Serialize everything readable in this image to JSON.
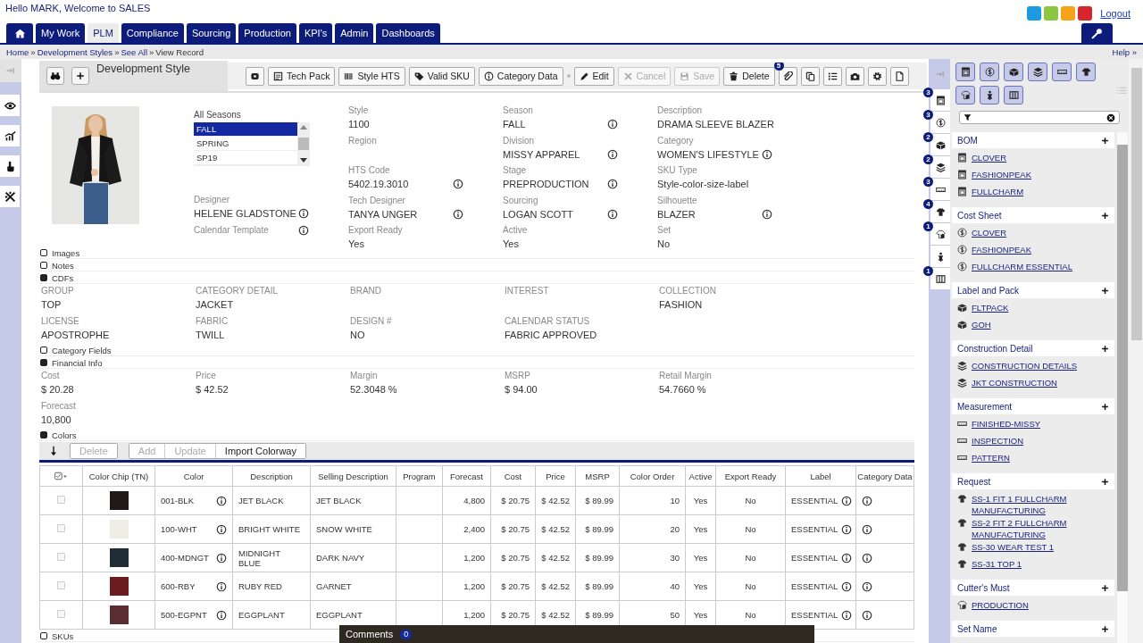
{
  "header": {
    "greeting": "Hello MARK, Welcome to SALES",
    "swatches": [
      {
        "color": "#1e9be0"
      },
      {
        "color": "#8dc63f"
      },
      {
        "color": "#f7a21b"
      },
      {
        "color": "#d7262b"
      }
    ],
    "logout": "Logout"
  },
  "nav": {
    "tabs": [
      {
        "kind": "home",
        "selected": false
      },
      {
        "label": "My Work",
        "selected": false
      },
      {
        "label": "PLM",
        "selected": true
      },
      {
        "label": "Compliance",
        "selected": false
      },
      {
        "label": "Sourcing",
        "selected": false
      },
      {
        "label": "Production",
        "selected": false
      },
      {
        "label": "KPI's",
        "selected": false
      },
      {
        "label": "Admin",
        "selected": false
      },
      {
        "label": "Dashboards",
        "selected": false
      }
    ]
  },
  "breadcrumb": {
    "separator": "»",
    "items": [
      "Home",
      "Development Styles",
      "See All",
      "View Record"
    ],
    "help": "Help »"
  },
  "toolbar": {
    "title": "Development Style",
    "buttons": [
      {
        "kind": "stop",
        "disabled": false
      },
      {
        "kind": "pdf",
        "label": "Tech Pack",
        "disabled": false
      },
      {
        "kind": "barcode",
        "label": "Style HTS",
        "disabled": false
      },
      {
        "kind": "tag",
        "label": "Valid SKU",
        "disabled": false
      },
      {
        "kind": "info",
        "label": "Category Data",
        "disabled": false
      },
      {
        "kind": "separator"
      },
      {
        "kind": "pencil",
        "label": "Edit",
        "disabled": false
      },
      {
        "kind": "cancel",
        "label": "Cancel",
        "disabled": true
      },
      {
        "kind": "save",
        "label": "Save",
        "disabled": true
      },
      {
        "kind": "trash",
        "label": "Delete",
        "disabled": false
      },
      {
        "kind": "paperclip",
        "badge": "5",
        "disabled": false
      },
      {
        "kind": "copy",
        "disabled": false
      },
      {
        "kind": "list",
        "disabled": false
      },
      {
        "kind": "camera",
        "disabled": false
      },
      {
        "kind": "gear",
        "disabled": false
      },
      {
        "kind": "document",
        "disabled": false
      }
    ]
  },
  "record": {
    "seasons": {
      "label": "All Seasons",
      "items": [
        {
          "label": "FALL",
          "selected": true
        },
        {
          "label": "SPRING",
          "selected": false
        },
        {
          "label": "SP19",
          "selected": false
        }
      ]
    },
    "seasons_column": [
      {
        "label": "Designer",
        "value": "HELENE GLADSTONE",
        "info": true
      },
      {
        "label": "Calendar Template",
        "info": true
      }
    ],
    "columns": [
      [
        {
          "label": "Style",
          "value": "1100",
          "info": false
        },
        {
          "label": "Region",
          "info": false
        },
        {
          "label": "HTS Code",
          "value": "5402.19.3010",
          "info": true
        },
        {
          "label": "Tech Designer",
          "value": "TANYA UNGER",
          "info": true
        },
        {
          "label": "Export Ready",
          "value": "Yes",
          "info": false
        }
      ],
      [
        {
          "label": "Season",
          "value": "FALL",
          "info": true
        },
        {
          "label": "Division",
          "value": "MISSY APPAREL",
          "info": true
        },
        {
          "label": "Stage",
          "value": "PREPRODUCTION",
          "info": true
        },
        {
          "label": "Sourcing",
          "value": "LOGAN SCOTT",
          "info": true
        },
        {
          "label": "Active",
          "value": "Yes",
          "info": false
        }
      ],
      [
        {
          "label": "Description",
          "value": "DRAMA SLEEVE BLAZER",
          "info": false
        },
        {
          "label": "Category",
          "value": "WOMEN'S LIFESTYLE",
          "info": true
        },
        {
          "label": "SKU Type",
          "value": "Style-color-size-label",
          "info": false
        },
        {
          "label": "Silhouette",
          "value": "BLAZER",
          "info": true
        },
        {
          "label": "Set",
          "value": "No",
          "info": false
        }
      ]
    ]
  },
  "sections": [
    {
      "title": "Images",
      "expanded": false
    },
    {
      "title": "Notes",
      "expanded": false
    },
    {
      "kind": "fields",
      "title": "CDFs",
      "expanded": true,
      "rows": [
        [
          {
            "label": "GROUP",
            "value": "TOP"
          },
          {
            "label": "CATEGORY DETAIL",
            "value": "JACKET"
          },
          {
            "label": "BRAND"
          },
          {
            "label": "INTEREST"
          },
          {
            "label": "COLLECTION",
            "value": "FASHION"
          }
        ],
        [
          {
            "label": "LICENSE",
            "value": "APOSTROPHE"
          },
          {
            "label": "FABRIC",
            "value": "TWILL"
          },
          {
            "label": "DESIGN #",
            "value": "NO"
          },
          {
            "label": "CALENDAR STATUS",
            "value": "FABRIC APPROVED"
          }
        ]
      ]
    },
    {
      "title": "Category Fields",
      "expanded": false
    },
    {
      "kind": "fields",
      "title": "Financial Info",
      "expanded": true,
      "rows": [
        [
          {
            "label": "Cost",
            "value": "$ 20.28"
          },
          {
            "label": "Price",
            "value": "$ 42.52"
          },
          {
            "label": "Margin",
            "value": "52.3048 %"
          },
          {
            "label": "MSRP",
            "value": "$ 94.00"
          },
          {
            "label": "Retail Margin",
            "value": "54.7660 %"
          }
        ],
        [
          {
            "label": "Forecast",
            "value": "10,800"
          }
        ]
      ]
    },
    {
      "kind": "table",
      "title": "Colors",
      "expanded": true,
      "actions": [
        {
          "label": "Delete",
          "disabled": true
        },
        {
          "label": "Add",
          "disabled": true
        },
        {
          "label": "Update",
          "disabled": true
        },
        {
          "label": "Import Colorway",
          "disabled": false
        }
      ],
      "columns": [
        "Color Chip (TN)",
        "Color",
        "Description",
        "Selling Description",
        "Program",
        "Forecast",
        "Cost",
        "Price",
        "MSRP",
        "Color Order",
        "Active",
        "Export Ready",
        "Label",
        "Category Data"
      ],
      "rows": [
        {
          "checked": false,
          "color": "#1f1a17",
          "cells": [
            null,
            "001-BLK",
            "JET BLACK",
            "JET BLACK",
            null,
            "4,800",
            "$ 20.75",
            "$ 42.52",
            "$ 89.99",
            "10",
            "Yes",
            "No",
            "ESSENTIAL"
          ]
        },
        {
          "checked": false,
          "color": "#eeede6",
          "cells": [
            null,
            "100-WHT",
            "BRIGHT WHITE",
            "SNOW WHITE",
            null,
            "2,400",
            "$ 20.75",
            "$ 42.52",
            "$ 89.99",
            "20",
            "Yes",
            "No",
            "ESSENTIAL"
          ]
        },
        {
          "checked": false,
          "color": "#1f2e36",
          "cells": [
            null,
            "400-MDNGT",
            "MIDNIGHT BLUE",
            "DARK NAVY",
            null,
            "1,200",
            "$ 20.75",
            "$ 42.52",
            "$ 89.99",
            "30",
            "Yes",
            "No",
            "ESSENTIAL"
          ]
        },
        {
          "checked": false,
          "color": "#6b1c1f",
          "cells": [
            null,
            "600-RBY",
            "RUBY RED",
            "GARNET",
            null,
            "1,200",
            "$ 20.75",
            "$ 42.52",
            "$ 89.99",
            "40",
            "Yes",
            "No",
            "ESSENTIAL"
          ]
        },
        {
          "checked": false,
          "color": "#5a2d33",
          "cells": [
            null,
            "500-EGPNT",
            "EGGPLANT",
            "EGGPLANT",
            null,
            "1,200",
            "$ 20.75",
            "$ 42.52",
            "$ 89.99",
            "50",
            "Yes",
            "No",
            "ESSENTIAL"
          ]
        }
      ]
    },
    {
      "title": "SKUs",
      "expanded": false
    }
  ],
  "comments": {
    "label": "Comments",
    "count": "0"
  },
  "side_tabs": [
    {
      "kind": "bom",
      "badge": "3"
    },
    {
      "kind": "cost",
      "badge": "3"
    },
    {
      "kind": "pack",
      "badge": "2"
    },
    {
      "kind": "construction",
      "badge": "2"
    },
    {
      "kind": "measurement",
      "badge": "3"
    },
    {
      "kind": "request",
      "badge": "4"
    },
    {
      "kind": "cutter",
      "badge": "1"
    },
    {
      "kind": "figure"
    },
    {
      "kind": "columns",
      "badge": "1"
    }
  ],
  "panel": {
    "filters": [
      {
        "kind": "bom"
      },
      {
        "kind": "cost"
      },
      {
        "kind": "pack"
      },
      {
        "kind": "construction"
      },
      {
        "kind": "measurement"
      },
      {
        "kind": "request"
      },
      {
        "kind": "cutter"
      },
      {
        "kind": "figure"
      },
      {
        "kind": "columns"
      }
    ],
    "groups": [
      {
        "kind": "bom",
        "title": "BOM",
        "items": [
          "CLOVER",
          "FASHIONPEAK",
          "FULLCHARM"
        ]
      },
      {
        "kind": "cost",
        "title": "Cost Sheet",
        "items": [
          "CLOVER",
          "FASHIONPEAK",
          "FULLCHARM ESSENTIAL"
        ]
      },
      {
        "kind": "pack",
        "title": "Label and Pack",
        "items": [
          "FLTPACK",
          "GOH"
        ]
      },
      {
        "kind": "construction",
        "title": "Construction Detail",
        "items": [
          "CONSTRUCTION DETAILS",
          "JKT CONSTRUCTION"
        ]
      },
      {
        "kind": "measurement",
        "title": "Measurement",
        "items": [
          "FINISHED-MISSY",
          "INSPECTION",
          "PATTERN"
        ]
      },
      {
        "kind": "request",
        "title": "Request",
        "items": [
          "SS-1 FIT 1 FULLCHARM MANUFACTURING",
          "SS-2 FIT 2 FULLCHARM MANUFACTURING",
          "SS-30 WEAR TEST 1",
          "SS-31 TOP 1"
        ]
      },
      {
        "kind": "cutter",
        "title": "Cutter's Must",
        "items": [
          "PRODUCTION"
        ]
      },
      {
        "title": "Set Name"
      }
    ]
  }
}
